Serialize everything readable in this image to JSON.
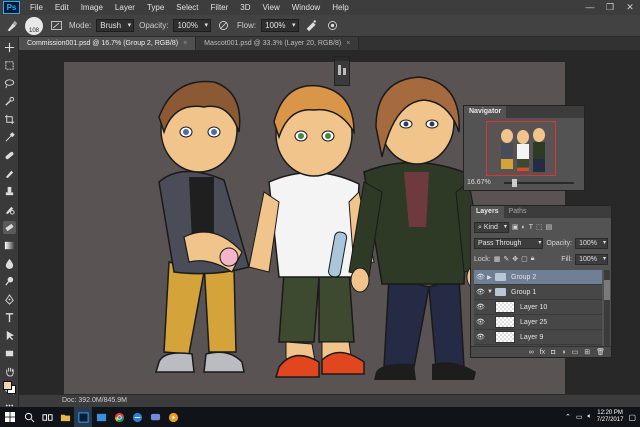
{
  "app": {
    "logo": "Ps"
  },
  "menu": [
    "File",
    "Edit",
    "Image",
    "Layer",
    "Type",
    "Select",
    "Filter",
    "3D",
    "View",
    "Window",
    "Help"
  ],
  "window_controls": [
    "—",
    "❐",
    "✕"
  ],
  "options_bar": {
    "brush_size": "108",
    "mode_label": "Mode:",
    "mode_value": "Brush",
    "opacity_label": "Opacity:",
    "opacity_value": "100%",
    "flow_label": "Flow:",
    "flow_value": "100%"
  },
  "tabs": [
    {
      "label": "Commission001.psd @ 16.7% (Group 2, RGB/8)",
      "close": "×",
      "active": true
    },
    {
      "label": "Mascot001.psd @ 33.3% (Layer 20, RGB/8)",
      "close": "×",
      "active": false
    }
  ],
  "tools": [
    "move-tool",
    "marquee-tool",
    "lasso-tool",
    "quick-select-tool",
    "crop-tool",
    "eyedropper-tool",
    "healing-tool",
    "brush-tool",
    "clone-stamp-tool",
    "history-brush-tool",
    "eraser-tool",
    "gradient-tool",
    "blur-tool",
    "dodge-tool",
    "pen-tool",
    "type-tool",
    "path-select-tool",
    "rectangle-tool",
    "hand-tool",
    "zoom-tool",
    "edit-toolbar-tool"
  ],
  "colors": {
    "foreground": "#f1d4b1",
    "background": "#ffffff",
    "canvas": "#595453",
    "selected_layer": "#6f7f96"
  },
  "status": {
    "doc": "Doc: 392.0M/845.9M"
  },
  "navigator": {
    "title": "Navigator",
    "zoom": "16.67%"
  },
  "layers": {
    "tabs": [
      "Layers",
      "Paths"
    ],
    "filter_kind": "Kind",
    "blend_mode": "Pass Through",
    "opacity_label": "Opacity:",
    "opacity_value": "100%",
    "lock_label": "Lock:",
    "fill_label": "Fill:",
    "fill_value": "100%",
    "items": [
      {
        "name": "Group 2",
        "type": "group",
        "expanded": false,
        "selected": true
      },
      {
        "name": "Group 1",
        "type": "group",
        "expanded": true,
        "selected": false
      },
      {
        "name": "Layer 10",
        "type": "layer",
        "selected": false
      },
      {
        "name": "Layer 25",
        "type": "layer",
        "selected": false
      },
      {
        "name": "Layer 9",
        "type": "layer",
        "selected": false
      }
    ]
  },
  "taskbar": {
    "time": "12:20 PM",
    "date": "7/27/2017",
    "apps": [
      "windows-start-icon",
      "search-icon",
      "task-view-icon",
      "folder-icon",
      "photoshop-icon",
      "file-explorer-icon",
      "chrome-icon",
      "edge-icon",
      "chat-icon",
      "media-icon"
    ]
  }
}
